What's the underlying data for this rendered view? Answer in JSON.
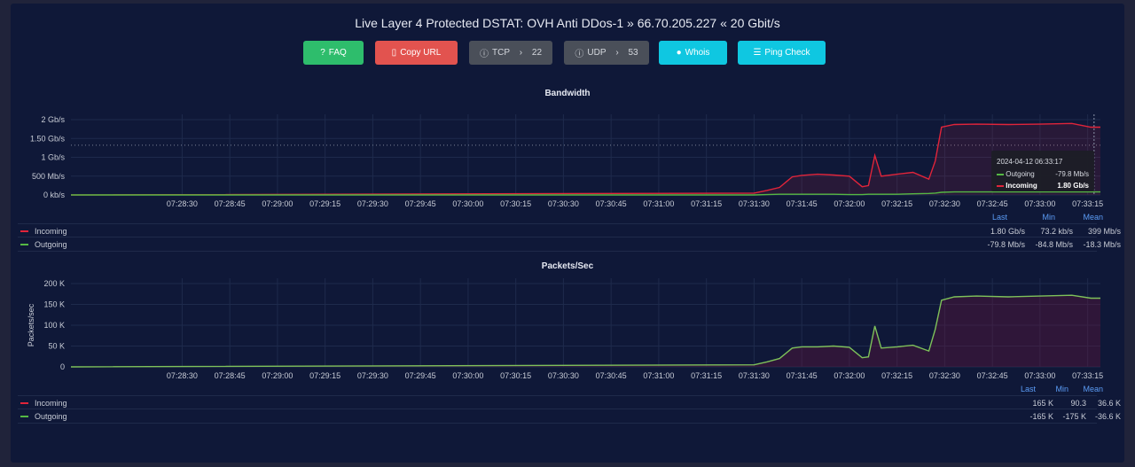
{
  "page": {
    "title": "Live Layer 4 Protected DSTAT: OVH Anti DDos-1 » 66.70.205.227 « 20 Gbit/s"
  },
  "buttons": [
    {
      "id": "faq",
      "label": "FAQ",
      "icon": "question-circle-icon",
      "glyph": "?"
    },
    {
      "id": "copy",
      "label": "Copy URL",
      "icon": "clipboard-icon",
      "glyph": "▯"
    },
    {
      "id": "tcp",
      "label": "TCP",
      "arrow": "›",
      "value": "22",
      "icon": "info-circle-icon",
      "glyph": "ⓘ"
    },
    {
      "id": "udp",
      "label": "UDP",
      "arrow": "›",
      "value": "53",
      "icon": "info-circle-icon",
      "glyph": "ⓘ"
    },
    {
      "id": "whois",
      "label": "Whois",
      "icon": "info-icon",
      "glyph": "●"
    },
    {
      "id": "ping",
      "label": "Ping Check",
      "icon": "list-check-icon",
      "glyph": "☰"
    }
  ],
  "colors": {
    "incoming": "#e0243a",
    "outgoing": "#55b844",
    "accent": "#5b9cf6",
    "panel": "#0f1838"
  },
  "x_ticks": [
    "07:28:30",
    "07:28:45",
    "07:29:00",
    "07:29:15",
    "07:29:30",
    "07:29:45",
    "07:30:00",
    "07:30:15",
    "07:30:30",
    "07:30:45",
    "07:31:00",
    "07:31:15",
    "07:31:30",
    "07:31:45",
    "07:32:00",
    "07:32:15",
    "07:32:30",
    "07:32:45",
    "07:33:00",
    "07:33:15"
  ],
  "legend_headers": [
    "Last",
    "Min",
    "Mean"
  ],
  "charts": {
    "bandwidth": {
      "title": "Bandwidth",
      "y_ticks": [
        "2 Gb/s",
        "1.50 Gb/s",
        "1 Gb/s",
        "500 Mb/s",
        "0 kb/s"
      ],
      "legend": [
        {
          "name": "Incoming",
          "last": "1.80 Gb/s",
          "min": "73.2 kb/s",
          "mean": "399 Mb/s"
        },
        {
          "name": "Outgoing",
          "last": "-79.8 Mb/s",
          "min": "-84.8 Mb/s",
          "mean": "-18.3 Mb/s"
        }
      ],
      "tooltip": {
        "time": "2024-04-12 06:33:17",
        "rows": [
          {
            "name": "Outgoing",
            "value": "-79.8 Mb/s"
          },
          {
            "name": "Incoming",
            "value": "1.80 Gb/s"
          }
        ]
      }
    },
    "packets": {
      "title": "Packets/Sec",
      "ylabel": "Packets/sec",
      "y_ticks": [
        "200 K",
        "150 K",
        "100 K",
        "50 K",
        "0"
      ],
      "legend": [
        {
          "name": "Incoming",
          "last": "165 K",
          "min": "90.3",
          "mean": "36.6 K"
        },
        {
          "name": "Outgoing",
          "last": "-165 K",
          "min": "-175 K",
          "mean": "-36.6 K"
        }
      ]
    }
  },
  "chart_data": [
    {
      "type": "line",
      "title": "Bandwidth",
      "x_unit": "time",
      "y_unit": "Gb/s",
      "ylim": [
        0,
        2
      ],
      "x": [
        "07:27:55",
        "07:31:30",
        "07:31:34",
        "07:31:38",
        "07:31:42",
        "07:31:45",
        "07:31:50",
        "07:31:55",
        "07:32:00",
        "07:32:04",
        "07:32:06",
        "07:32:08",
        "07:32:10",
        "07:32:15",
        "07:32:20",
        "07:32:25",
        "07:32:27",
        "07:32:29",
        "07:32:33",
        "07:32:40",
        "07:32:50",
        "07:33:00",
        "07:33:10",
        "07:33:16",
        "07:33:19"
      ],
      "series": [
        {
          "name": "Incoming",
          "values": [
            0,
            0.05,
            0.12,
            0.2,
            0.48,
            0.52,
            0.55,
            0.53,
            0.5,
            0.22,
            0.25,
            1.05,
            0.5,
            0.55,
            0.6,
            0.42,
            0.9,
            1.8,
            1.87,
            1.88,
            1.87,
            1.88,
            1.9,
            1.8,
            1.8
          ]
        },
        {
          "name": "Outgoing",
          "values": [
            0,
            0,
            0.01,
            0.02,
            0.02,
            0.02,
            0.02,
            0.02,
            0.01,
            0.01,
            0.02,
            0.02,
            0.02,
            0.02,
            0.03,
            0.04,
            0.05,
            0.07,
            0.08,
            0.08,
            0.08,
            0.08,
            0.08,
            0.08,
            0.08
          ]
        }
      ]
    },
    {
      "type": "line",
      "title": "Packets/Sec",
      "ylabel": "Packets/sec",
      "ylim": [
        0,
        200000
      ],
      "x": [
        "07:27:55",
        "07:31:30",
        "07:31:34",
        "07:31:38",
        "07:31:42",
        "07:31:45",
        "07:31:50",
        "07:31:55",
        "07:32:00",
        "07:32:04",
        "07:32:06",
        "07:32:08",
        "07:32:10",
        "07:32:15",
        "07:32:20",
        "07:32:25",
        "07:32:27",
        "07:32:29",
        "07:32:33",
        "07:32:40",
        "07:32:50",
        "07:33:00",
        "07:33:10",
        "07:33:16",
        "07:33:19"
      ],
      "series": [
        {
          "name": "Outgoing",
          "values": [
            0,
            5000,
            12000,
            20000,
            45000,
            48000,
            48000,
            50000,
            47000,
            22000,
            24000,
            98000,
            45000,
            48000,
            52000,
            38000,
            90000,
            160000,
            168000,
            170000,
            168000,
            170000,
            172000,
            165000,
            165000
          ]
        }
      ]
    }
  ]
}
